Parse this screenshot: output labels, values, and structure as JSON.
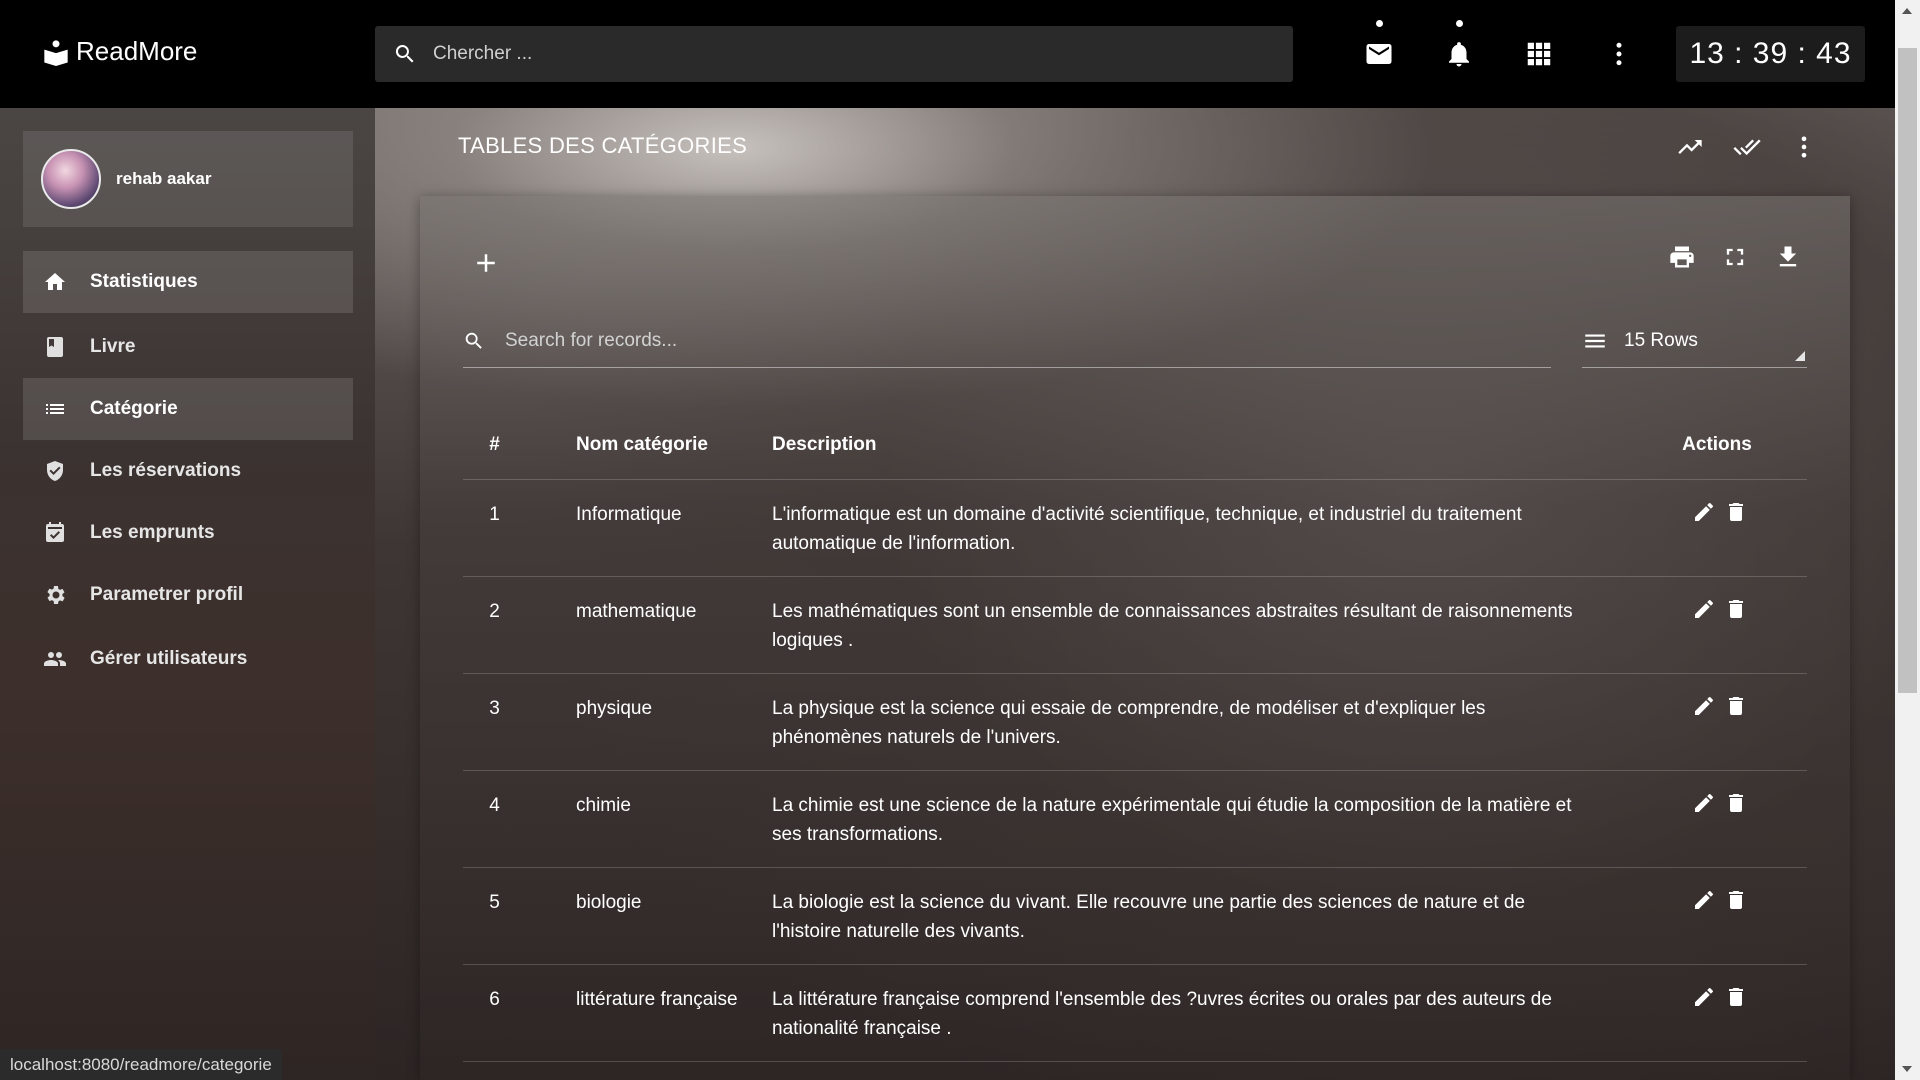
{
  "brand": {
    "name": "ReadMore",
    "icon": "book-reader-icon"
  },
  "topbar": {
    "search_placeholder": "Chercher ...",
    "icons": [
      "mail-icon",
      "bell-icon",
      "apps-grid-icon",
      "more-vert-icon"
    ],
    "clock": "13 : 39 : 43"
  },
  "sidebar": {
    "user": {
      "name": "rehab aakar"
    },
    "items": [
      {
        "label": "Statistiques",
        "icon": "home-icon"
      },
      {
        "label": "Livre",
        "icon": "book-icon"
      },
      {
        "label": "Catégorie",
        "icon": "list-icon"
      },
      {
        "label": "Les réservations",
        "icon": "shield-check-icon"
      },
      {
        "label": "Les emprunts",
        "icon": "calendar-check-icon"
      },
      {
        "label": "Parametrer profil",
        "icon": "gear-icon"
      },
      {
        "label": "Gérer utilisateurs",
        "icon": "people-icon"
      }
    ]
  },
  "main": {
    "title": "TABLES DES CATÉGORIES",
    "header_icons": [
      "trending-up-icon",
      "done-all-icon",
      "more-vert-icon"
    ],
    "toolbar_icons": [
      "add-icon",
      "print-icon",
      "fullscreen-icon",
      "download-icon"
    ],
    "search_placeholder": "Search for records...",
    "rows_label": "15 Rows",
    "table": {
      "headers": [
        "#",
        "Nom catégorie",
        "Description",
        "Actions"
      ],
      "rows": [
        {
          "num": "1",
          "name": "Informatique",
          "desc": "L'informatique est un domaine d'activité scientifique, technique, et industriel du traitement automatique de l'information."
        },
        {
          "num": "2",
          "name": "mathematique",
          "desc": "Les mathématiques sont un ensemble de connaissances abstraites résultant de raisonnements logiques ."
        },
        {
          "num": "3",
          "name": "physique",
          "desc": "La physique est la science qui essaie de comprendre, de modéliser et d'expliquer les phénomènes naturels de l'univers."
        },
        {
          "num": "4",
          "name": "chimie",
          "desc": "La chimie est une science de la nature expérimentale qui étudie la composition de la matière et ses transformations."
        },
        {
          "num": "5",
          "name": "biologie",
          "desc": "La biologie est la science du vivant. Elle recouvre une partie des sciences de nature et de l'histoire naturelle des vivants."
        },
        {
          "num": "6",
          "name": "littérature française",
          "desc": "La littérature française comprend l'ensemble des ?uvres écrites ou orales par des auteurs de nationalité française ."
        }
      ]
    }
  },
  "status_bar": {
    "url": "localhost:8080/readmore/categorie"
  }
}
